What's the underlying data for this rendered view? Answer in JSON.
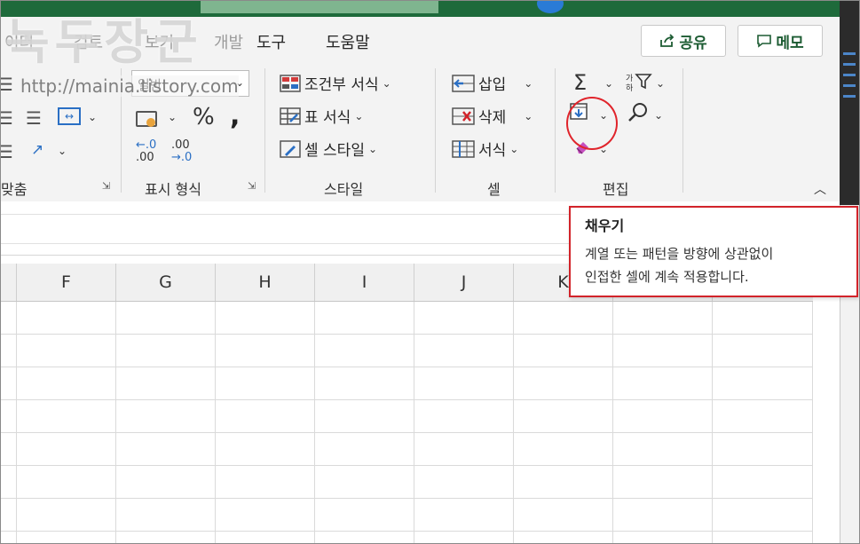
{
  "tabs": {
    "layout_ghost": "이터",
    "review_ghost": "검토",
    "view_ghost": "보기",
    "dev_ghost": "개발",
    "tools": "도구",
    "help": "도움말"
  },
  "buttons": {
    "share": "공유",
    "memo": "메모"
  },
  "watermark": {
    "title": "녹두장군",
    "url": "http://mainia.tistory.com"
  },
  "number_group": {
    "format_value": "일반",
    "percent": "%",
    "comma": ",",
    "dec_inc_a": "←.0",
    "dec_inc_b": ".00",
    "dec_dec_a": ".00",
    "dec_dec_b": "→.0",
    "label": "표시 형식"
  },
  "alignment_group": {
    "label": "맞춤"
  },
  "styles_group": {
    "conditional": "조건부 서식",
    "table": "표 서식",
    "cell_style": "셀 스타일",
    "label": "스타일"
  },
  "cells_group": {
    "insert": "삽입",
    "delete": "삭제",
    "format": "서식",
    "label": "셀"
  },
  "editing_group": {
    "label": "편집"
  },
  "columns": [
    "F",
    "G",
    "H",
    "I",
    "J",
    "K"
  ],
  "tooltip": {
    "title": "채우기",
    "line1": "계열 또는 패턴을 방향에 상관없이",
    "line2": "인접한 셀에 계속 적용합니다."
  },
  "colors": {
    "excel_green": "#1e6a3b",
    "accent_red": "#d2232a",
    "ribbon_bg": "#f3f3f3"
  }
}
